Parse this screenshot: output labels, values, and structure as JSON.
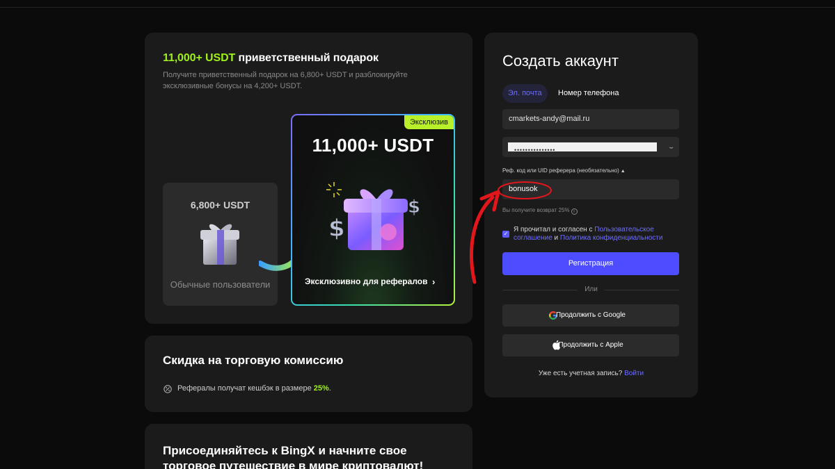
{
  "gift_card": {
    "title_accent": "11,000+ USDT",
    "title_rest": " приветственный подарок",
    "subtitle": "Получите приветственный подарок на 6,800+ USDT и разблокируйте эксклюзивные бонусы на 4,200+ USDT.",
    "regular": {
      "amount": "6,800+ USDT",
      "label": "Обычные пользователи"
    },
    "exclusive": {
      "badge": "Эксклюзив",
      "amount": "11,000+ USDT",
      "link": "Эксклюзивно для рефералов",
      "chevron": "›"
    }
  },
  "discount_card": {
    "title": "Скидка на торговую комиссию",
    "text": "Рефералы получат кешбэк в размере ",
    "percent": "25%",
    "dot": "."
  },
  "join_card": {
    "title": "Присоединяйтесь к BingX и начните свое торговое путешествие в мире криптовалют!"
  },
  "form": {
    "title": "Создать аккаунт",
    "tabs": [
      {
        "label": "Эл. почта",
        "active": true
      },
      {
        "label": "Номер телефона",
        "active": false
      }
    ],
    "email_value": "cmarkets-andy@mail.ru",
    "password_mask": "•••••••••••••••",
    "ref_label": "Реф. код или UID реферера (необязательно)",
    "ref_value": "bonusok",
    "cashback_note": "Вы получите возврат 25%",
    "agreement": {
      "prefix": "Я прочитал и согласен с ",
      "link1": "Пользовательское соглашение",
      "middle": " и ",
      "link2": "Политика конфиденциальности"
    },
    "register_button": "Регистрация",
    "or_text": "Или",
    "google_button": "Продолжить с Google",
    "apple_button": "Продолжить с Apple",
    "have_account": "Уже есть учетная запись? ",
    "login_link": "Войти"
  },
  "colors": {
    "accent_green": "#9ef01a",
    "primary_blue": "#4d4dff",
    "annotation_red": "#e3161c"
  }
}
